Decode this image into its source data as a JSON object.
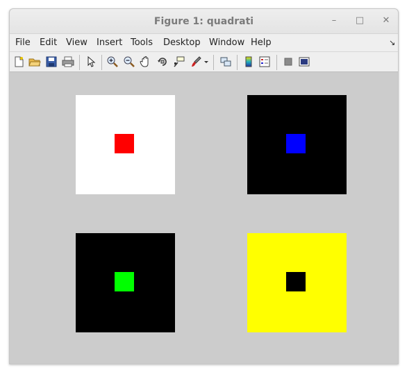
{
  "window": {
    "title": "Figure 1: quadrati",
    "controls": {
      "minimize": "–",
      "maximize": "□",
      "close": "✕"
    }
  },
  "menubar": {
    "items": [
      {
        "label": "File"
      },
      {
        "label": "Edit"
      },
      {
        "label": "View"
      },
      {
        "label": "Insert"
      },
      {
        "label": "Tools"
      },
      {
        "label": "Desktop"
      },
      {
        "label": "Window"
      },
      {
        "label": "Help"
      }
    ],
    "dock_arrow": "↘"
  },
  "toolbar": {
    "icons": [
      "new-figure-icon",
      "open-file-icon",
      "save-icon",
      "print-icon",
      "pointer-icon",
      "zoom-in-icon",
      "zoom-out-icon",
      "pan-hand-icon",
      "rotate-3d-icon",
      "data-cursor-icon",
      "brush-icon",
      "dropdown-arrow-icon",
      "link-plot-icon",
      "colorbar-icon",
      "legend-icon",
      "hide-plot-tools-icon",
      "show-plot-tools-icon"
    ]
  },
  "squares": [
    {
      "outer": "#ffffff",
      "inner": "#ff0000"
    },
    {
      "outer": "#000000",
      "inner": "#0000ff"
    },
    {
      "outer": "#000000",
      "inner": "#00ff00"
    },
    {
      "outer": "#ffff00",
      "inner": "#000000"
    }
  ]
}
